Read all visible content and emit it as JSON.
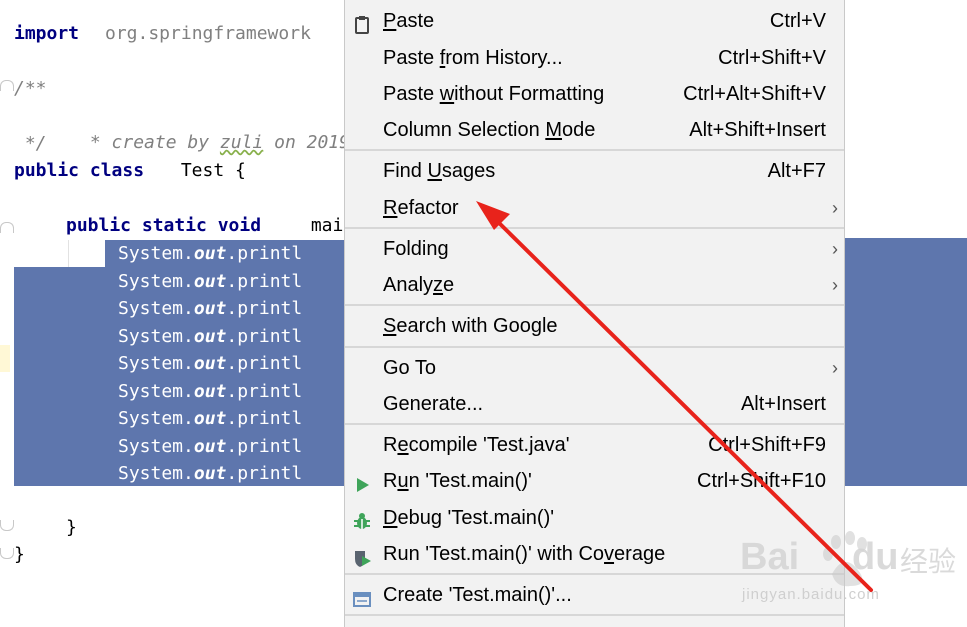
{
  "editor": {
    "import_kw": "import",
    "import_rest": "org.springframework",
    "comment_open": "/**",
    "comment_body_pre": " * create by ",
    "comment_author": "zuli",
    "comment_body_post": " on 2019/",
    "comment_close": " */",
    "class_kw": "public class",
    "class_name": " Test {",
    "method_kw": "public static void",
    "method_rest": " mai",
    "println_prefix": "System.",
    "println_out": "out",
    "println_suffix": ".printl",
    "println_count": 9,
    "close_method": "}",
    "close_class": "}"
  },
  "context_menu": {
    "items": [
      {
        "pre": "",
        "u": "P",
        "post": "aste",
        "shortcut": "Ctrl+V",
        "icon": "clipboard-icon"
      },
      {
        "pre": "Paste ",
        "u": "f",
        "post": "rom History...",
        "shortcut": "Ctrl+Shift+V"
      },
      {
        "pre": "Paste ",
        "u": "w",
        "post": "ithout Formatting",
        "shortcut": "Ctrl+Alt+Shift+V"
      },
      {
        "pre": "Column Selection ",
        "u": "M",
        "post": "ode",
        "shortcut": "Alt+Shift+Insert"
      },
      {
        "pre": "Find ",
        "u": "U",
        "post": "sages",
        "shortcut": "Alt+F7"
      },
      {
        "pre": "",
        "u": "R",
        "post": "efactor",
        "shortcut": "",
        "submenu": true
      },
      {
        "pre": "Folding",
        "u": "",
        "post": "",
        "shortcut": "",
        "submenu": true
      },
      {
        "pre": "Analy",
        "u": "z",
        "post": "e",
        "shortcut": "",
        "submenu": true
      },
      {
        "pre": "",
        "u": "S",
        "post": "earch with Google",
        "shortcut": ""
      },
      {
        "pre": "Go To",
        "u": "",
        "post": "",
        "shortcut": "",
        "submenu": true
      },
      {
        "pre": "Generate...",
        "u": "",
        "post": "",
        "shortcut": "Alt+Insert"
      },
      {
        "pre": "R",
        "u": "e",
        "post": "compile 'Test.java'",
        "shortcut": "Ctrl+Shift+F9"
      },
      {
        "pre": "R",
        "u": "u",
        "post": "n 'Test.main()'",
        "shortcut": "Ctrl+Shift+F10",
        "icon": "run-icon"
      },
      {
        "pre": "",
        "u": "D",
        "post": "ebug 'Test.main()'",
        "shortcut": "",
        "icon": "debug-icon"
      },
      {
        "pre": "Run 'Test.main()' with Co",
        "u": "v",
        "post": "erage",
        "shortcut": "",
        "icon": "coverage-icon"
      },
      {
        "pre": "Create 'Test.main()'...",
        "u": "",
        "post": "",
        "shortcut": "",
        "icon": "create-config-icon"
      }
    ]
  },
  "watermark": {
    "logo_text": "Bai",
    "logo_text2": "du",
    "cn_text": "经验",
    "url": "jingyan.baidu.com"
  },
  "colors": {
    "selection": "#5e76ad",
    "keyword": "#000080",
    "menu_bg": "#f2f2f2",
    "arrow": "#e8231b"
  }
}
